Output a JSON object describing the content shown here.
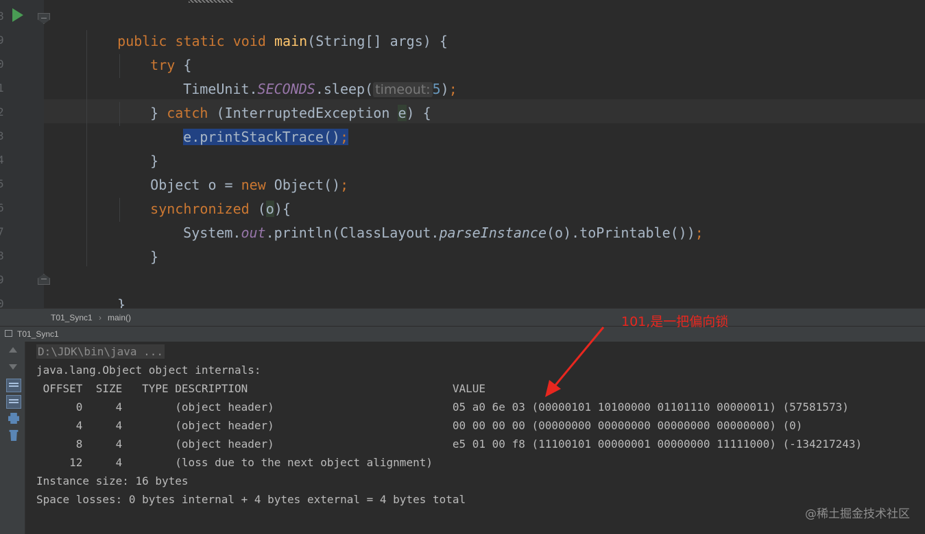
{
  "editor": {
    "code": {
      "l1_public": "public",
      "l1_static": "static",
      "l1_void": "void",
      "l1_main": "main",
      "l1_rest": "(String[] args) {",
      "l2_try": "try",
      "l2_brace": "{",
      "l3_timeunit": "TimeUnit.",
      "l3_seconds": "SECONDS",
      "l3_sleep": ".sleep(",
      "l3_hint": "timeout:",
      "l3_num": "5",
      "l3_end": ")",
      "l3_semi": ";",
      "l4_close": "}",
      "l4_catch": "catch",
      "l4_type": "(InterruptedException",
      "l4_var": "e",
      "l4_end": ") {",
      "l5_call": "e.printStackTrace()",
      "l5_semi": ";",
      "l6_close": "}",
      "l7_decl": "Object o = ",
      "l7_new": "new",
      "l7_ctor": " Object()",
      "l7_semi": ";",
      "l8_sync": "synchronized",
      "l8_open": " (",
      "l8_var": "o",
      "l8_close": "){",
      "l9_system": "System.",
      "l9_out": "out",
      "l9_println": ".println(ClassLayout.",
      "l9_parse": "parseInstance",
      "l9_rest": "(o).toPrintable())",
      "l9_semi": ";",
      "l10_close": "}",
      "l12_close": "}",
      "l13_close": "}"
    },
    "gutter_numbers": [
      "8",
      "9",
      "0",
      "1",
      "2",
      "3",
      "4",
      "5",
      "6",
      "7",
      "8",
      "9",
      "0"
    ]
  },
  "breadcrumb": {
    "class_name": "T01_Sync1",
    "separator": "›",
    "method": "main()"
  },
  "run_panel": {
    "tab_label": "T01_Sync1"
  },
  "console": {
    "command": "D:\\JDK\\bin\\java ...",
    "internals_title": "java.lang.Object object internals:",
    "header_row": " OFFSET  SIZE   TYPE DESCRIPTION                               VALUE",
    "rows": [
      "      0     4        (object header)                           05 a0 6e 03 (00000101 10100000 01101110 00000011) (57581573)",
      "      4     4        (object header)                           00 00 00 00 (00000000 00000000 00000000 00000000) (0)",
      "      8     4        (object header)                           e5 01 00 f8 (11100101 00000001 00000000 11111000) (-134217243)",
      "     12     4        (loss due to the next object alignment)"
    ],
    "instance_size": "Instance size: 16 bytes",
    "space_losses": "Space losses: 0 bytes internal + 4 bytes external = 4 bytes total"
  },
  "annotation": {
    "text": "101,是一把偏向锁",
    "color": "#e8271f"
  },
  "watermark": "@稀土掘金技术社区",
  "colors": {
    "keyword": "#cc7832",
    "method": "#ffc66d",
    "field": "#9876aa",
    "number": "#6897bb",
    "text": "#a9b7c6",
    "selection": "#214283",
    "background": "#2b2b2b"
  }
}
